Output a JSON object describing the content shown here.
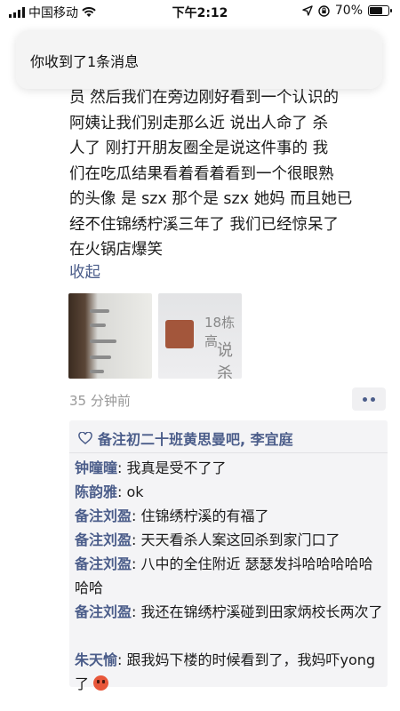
{
  "status_bar": {
    "carrier": "中国移动",
    "time": "下午2:12",
    "battery": "70%",
    "battery_level": 0.7
  },
  "notification": {
    "text": "你收到了1条消息"
  },
  "post": {
    "lines": [
      "员 然后我们在旁边刚好看到一个认识的",
      "阿姨让我们别走那么近 说出人命了 杀",
      "人了 刚打开朋友圈全是说这件事的 我",
      "们在吃瓜结果看着看着看到一个很眼熟",
      "的头像 是 szx 那个是 szx 她妈 而且她已",
      "经不住锦绣柠溪三年了 我们已经惊呆了",
      "在火锅店爆笑"
    ],
    "collapse_label": "收起",
    "photo2_text_a": "18栋高",
    "photo2_text_b": "说杀",
    "time_ago": "35 分钟前"
  },
  "likes": {
    "names": "备注初二十班黄思曼吧, 李宜庭"
  },
  "comments": [
    {
      "name": "钟曈曈",
      "text": "我真是受不了了"
    },
    {
      "name": "陈韵雅",
      "text": "ok"
    },
    {
      "name": "备注刘盈",
      "text": "住锦绣柠溪的有福了"
    },
    {
      "name": "备注刘盈",
      "text": "天天看杀人案这回杀到家门口了"
    },
    {
      "name": "备注刘盈",
      "text": "八中的全住附近 瑟瑟发抖哈哈哈哈哈哈哈"
    },
    {
      "name": "备注刘盈",
      "text": "我还在锦绣柠溪碰到田家炳校长两次了"
    },
    {
      "name": "朱天愉",
      "text": "跟我妈下楼的时候看到了，我妈吓yong了"
    }
  ],
  "colors": {
    "link": "#4b5d8a",
    "comment_bg": "#f4f4f6",
    "banner_bg": "#f4f4f4"
  }
}
